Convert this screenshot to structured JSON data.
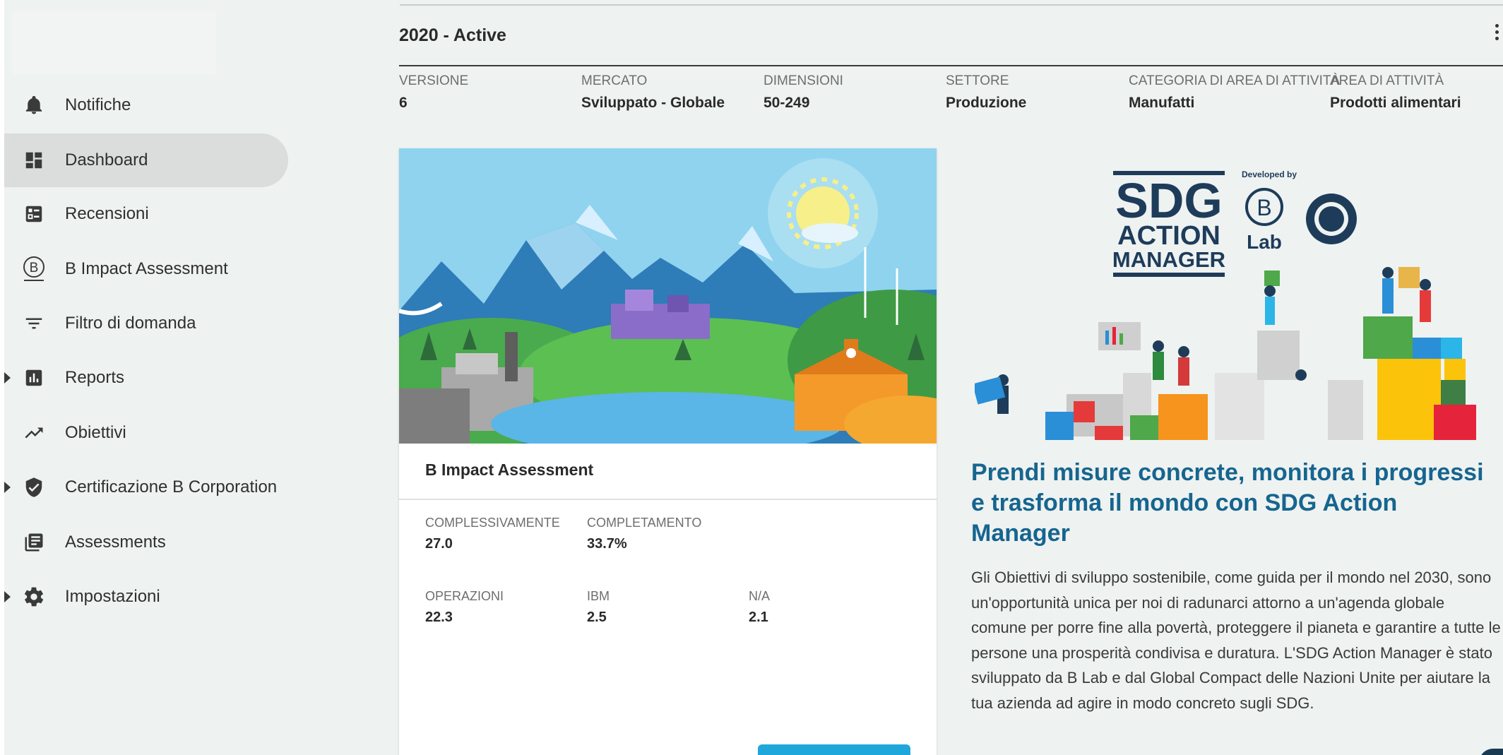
{
  "sidebar": {
    "items": [
      {
        "label": "Notifiche",
        "icon": "bell-icon"
      },
      {
        "label": "Dashboard",
        "icon": "dashboard-icon",
        "active": true
      },
      {
        "label": "Recensioni",
        "icon": "reviews-icon"
      },
      {
        "label": "B Impact Assessment",
        "icon": "b-logo-icon"
      },
      {
        "label": "Filtro di domanda",
        "icon": "filter-icon"
      },
      {
        "label": "Reports",
        "icon": "bar-chart-icon",
        "expandable": true
      },
      {
        "label": "Obiettivi",
        "icon": "trending-up-icon"
      },
      {
        "label": "Certificazione B Corporation",
        "icon": "shield-check-icon",
        "expandable": true
      },
      {
        "label": "Assessments",
        "icon": "document-list-icon"
      },
      {
        "label": "Impostazioni",
        "icon": "gear-icon",
        "expandable": true
      }
    ]
  },
  "header": {
    "title": "2020 - Active",
    "meta": [
      {
        "key": "VERSIONE",
        "value": "6"
      },
      {
        "key": "MERCATO",
        "value": "Sviluppato - Globale"
      },
      {
        "key": "DIMENSIONI",
        "value": "50-249"
      },
      {
        "key": "SETTORE",
        "value": "Produzione"
      },
      {
        "key": "CATEGORIA DI AREA DI ATTIVITÀ",
        "value": "Manufatti"
      },
      {
        "key": "AREA DI ATTIVITÀ",
        "value": "Prodotti alimentari"
      }
    ]
  },
  "card": {
    "title": "B Impact Assessment",
    "stats": [
      {
        "key": "COMPLESSIVAMENTE",
        "value": "27.0"
      },
      {
        "key": "COMPLETAMENTO",
        "value": "33.7%"
      },
      {
        "key": "OPERAZIONI",
        "value": "22.3"
      },
      {
        "key": "IBM",
        "value": "2.5"
      },
      {
        "key": "N/A",
        "value": "2.1"
      }
    ]
  },
  "sdg": {
    "logo_line1": "SDG",
    "logo_line2": "ACTION",
    "logo_line3": "MANAGER",
    "developed_by": "Developed by",
    "blab": "Lab",
    "heading": "Prendi misure concrete, monitora i progressi e trasforma il mondo con SDG Action Manager",
    "body": "Gli Obiettivi di sviluppo sostenibile, come guida per il mondo nel 2030, sono un'opportunità unica per noi di radunarci attorno a un'agenda globale comune per porre fine alla povertà, proteggere il pianeta e garantire a tutte le persone una prosperità condivisa e duratura. L'SDG Action Manager è stato sviluppato da B Lab e dal Global Compact delle Nazioni Unite per aiutare la tua azienda ad agire in modo concreto sugli SDG."
  },
  "colors": {
    "accent": "#1fa7dc",
    "heading_blue": "#16658f",
    "background": "#eef2f1"
  }
}
